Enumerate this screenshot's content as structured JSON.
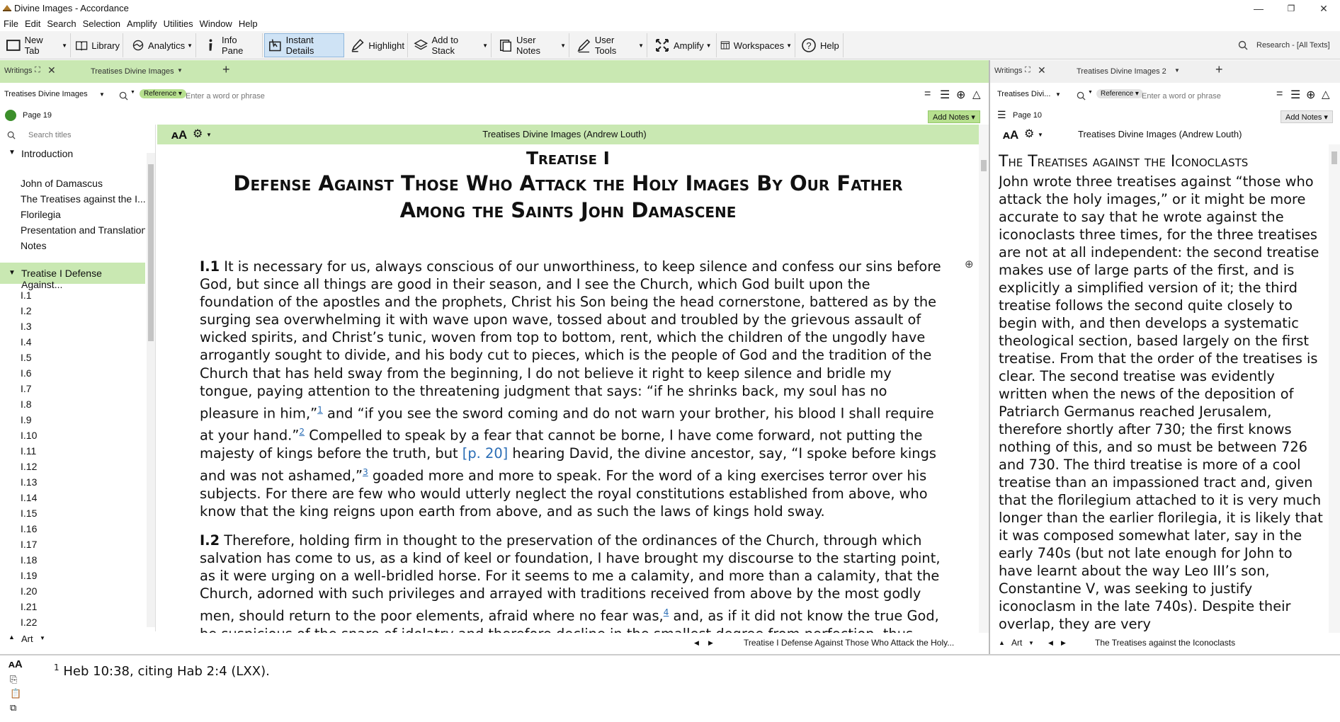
{
  "window": {
    "title": "Divine Images - Accordance",
    "controls": [
      "—",
      "❐",
      "✕"
    ]
  },
  "menu": [
    "File",
    "Edit",
    "Search",
    "Selection",
    "Amplify",
    "Utilities",
    "Window",
    "Help"
  ],
  "toolbar": {
    "new_tab": "New Tab",
    "library": "Library",
    "analytics": "Analytics",
    "info_pane": "Info Pane",
    "instant_details": "Instant Details",
    "highlight": "Highlight",
    "add_to_stack": "Add to Stack",
    "user_notes": "User Notes",
    "user_tools": "User Tools",
    "amplify": "Amplify",
    "workspaces": "Workspaces",
    "help": "Help",
    "research": "Research - [All Texts]"
  },
  "left_pane": {
    "writings_label": "Writings",
    "tab_title": "Treatises Divine Images",
    "module_select": "Treatises Divine Images",
    "search_mode": "Reference",
    "search_placeholder": "Enter a word or phrase",
    "page_label": "Page 19",
    "add_notes": "Add Notes",
    "search_titles_placeholder": "Search titles",
    "doc_header": "Treatises Divine Images (Andrew Louth)",
    "nav": {
      "intro_heading": "Introduction",
      "intro_items": [
        "John of Damascus",
        "The Treatises against the I...",
        "Florilegia",
        "Presentation and Translation",
        "Notes"
      ],
      "treatise_heading": "Treatise I Defense Against...",
      "treatise_items": [
        "I.1",
        "I.2",
        "I.3",
        "I.4",
        "I.5",
        "I.6",
        "I.7",
        "I.8",
        "I.9",
        "I.10",
        "I.11",
        "I.12",
        "I.13",
        "I.14",
        "I.15",
        "I.16",
        "I.17",
        "I.18",
        "I.19",
        "I.20",
        "I.21",
        "I.22"
      ],
      "footer_label": "Art"
    },
    "heading_line1": "Treatise I",
    "heading_line2": "Defense Against Those Who Attack the Holy Images By Our Father Among the Saints John Damascene",
    "para1": {
      "num": "I.1",
      "a": "It is necessary for us, always conscious of our unworthiness, to keep silence and confess our sins before God, but since all things are good in their season, and I see the Church, which God built upon the foundation of the apostles and the prophets, Christ his Son being the head cornerstone, battered as by the surging sea overwhelming it with wave upon wave, tossed about and troubled by the grievous assault of wicked spirits, and Christ’s tunic, woven from top to bottom, rent, which the children of the ungodly have arrogantly sought to divide, and his body cut to pieces, which is the people of God and the tradition of the Church that has held sway from the beginning, I do not believe it right to keep silence and bridle my tongue, paying attention to the threatening judgment that says: “if he shrinks back, my soul has no pleasure in him,”",
      "fn1": "1",
      "b": " and “if you see the sword coming and do not warn your brother, his blood I shall require at your hand.”",
      "fn2": "2",
      "c": " Compelled to speak by a fear that cannot be borne, I have come forward, not putting the majesty of kings before the truth, but ",
      "pageref": "[p. 20]",
      "d": " hearing David, the divine ancestor, say, “I spoke before kings and was not ashamed,”",
      "fn3": "3",
      "e": " goaded more and more to speak. For the word of a king exercises terror over his subjects. For there are few who would utterly neglect the royal constitutions established from above, who know that the king reigns upon earth from above, and as such the laws of kings hold sway."
    },
    "para2": {
      "num": "I.2",
      "a": "Therefore, holding firm in thought to the preservation of the ordinances of the Church, through which salvation has come to us, as a kind of keel or foundation, I have brought my discourse to the starting point, as it were urging on a well-bridled horse. For it seems to me a calamity, and more than a calamity, that the Church, adorned with such privileges and arrayed with traditions received from above by the most godly men, should return to the poor elements, afraid where no fear was,",
      "fn4": "4",
      "b": " and, as if it did not know the true God, be suspicious of the snare of idolatry and therefore decline in the smallest degree from perfection, thus bearing a disfiguring"
    },
    "status_location": "Treatise I Defense Against Those Who Attack the Holy..."
  },
  "right_pane": {
    "writings_label": "Writings",
    "tab_title": "Treatises Divine Images 2",
    "module_select": "Treatises Divi...",
    "search_mode": "Reference",
    "search_placeholder": "Enter a word or phrase",
    "page_label": "Page 10",
    "add_notes": "Add Notes",
    "doc_header": "Treatises Divine Images (Andrew Louth)",
    "heading": "The Treatises against the Iconoclasts",
    "body": "John wrote three treatises against “those who attack the holy images,” or it might be more accurate to say that he wrote against the iconoclasts three times, for the three treatises are not at all independent: the second treatise makes use of large parts of the first, and is explicitly a simplified version of it; the third treatise follows the second quite closely to begin with, and then develops a systematic theological section, based largely on the first treatise. From that the order of the treatises is clear. The second treatise was evidently written when the news of the deposition of Patriarch Germanus reached Jerusalem, therefore shortly after 730; the first knows nothing of this, and so must be between 726 and 730. The third treatise is more of a cool treatise than an impassioned tract and, given that the florilegium attached to it is very much longer than the earlier florilegia, it is likely that it was composed somewhat later, say in the early 740s (but not late enough for John to have learnt about the way Leo III’s son, Constantine V, was seeking to justify iconoclasm in the late 740s). Despite their overlap, they are very",
    "footer_label": "Art",
    "status_location": "The Treatises against the Iconoclasts"
  },
  "footnote_pane": {
    "num": "1",
    "text": "Heb 10:38, citing Hab 2:4 (LXX)."
  },
  "colors": {
    "accent_green": "#c9e8b2",
    "link_blue": "#2a6db5",
    "active_button": "#cfe3f5"
  }
}
